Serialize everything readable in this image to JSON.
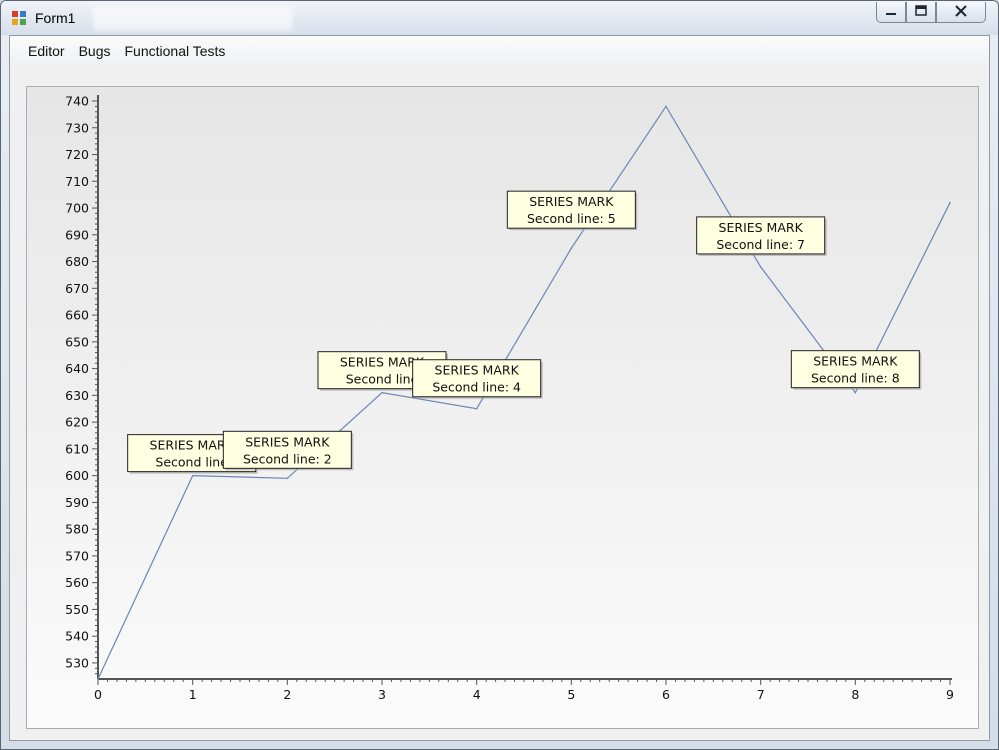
{
  "window": {
    "title": "Form1",
    "buttons": {
      "minimize": "minimize-icon",
      "maximize": "restore-icon",
      "close": "close-icon"
    }
  },
  "menu": {
    "items": [
      {
        "label": "Editor"
      },
      {
        "label": "Bugs"
      },
      {
        "label": "Functional Tests"
      }
    ]
  },
  "colors": {
    "line": "#6b86b8",
    "tooltip_bg": "#ffffe1",
    "axis": "#555555"
  },
  "chart_data": {
    "type": "line",
    "x": [
      0,
      1,
      2,
      3,
      4,
      5,
      6,
      7,
      8,
      9
    ],
    "series": [
      {
        "values": [
          524,
          600,
          599,
          631,
          625,
          685,
          738,
          678,
          631,
          702
        ]
      }
    ],
    "xticks": [
      "0",
      "1",
      "2",
      "3",
      "4",
      "5",
      "6",
      "7",
      "8",
      "9"
    ],
    "yticks": [
      "740",
      "730",
      "720",
      "710",
      "700",
      "690",
      "680",
      "670",
      "660",
      "650",
      "640",
      "630",
      "620",
      "610",
      "600",
      "590",
      "580",
      "570",
      "560",
      "550",
      "540",
      "530"
    ],
    "xlim": [
      0,
      9
    ],
    "ylim": [
      524,
      740
    ],
    "grid": false,
    "annotations": [
      {
        "title": "SERIES MARK",
        "text": "Second line",
        "x": 1
      },
      {
        "title": "SERIES MARK",
        "text": "Second line: 2",
        "x": 2
      },
      {
        "title": "SERIES MARK",
        "text": "Second line",
        "x": 3
      },
      {
        "title": "SERIES MARK",
        "text": "Second line: 4",
        "x": 4
      },
      {
        "title": "SERIES MARK",
        "text": "Second line: 5",
        "x": 5
      },
      {
        "title": "SERIES MARK",
        "text": "Second line: 7",
        "x": 7
      },
      {
        "title": "SERIES MARK",
        "text": "Second line: 8",
        "x": 8
      }
    ]
  }
}
